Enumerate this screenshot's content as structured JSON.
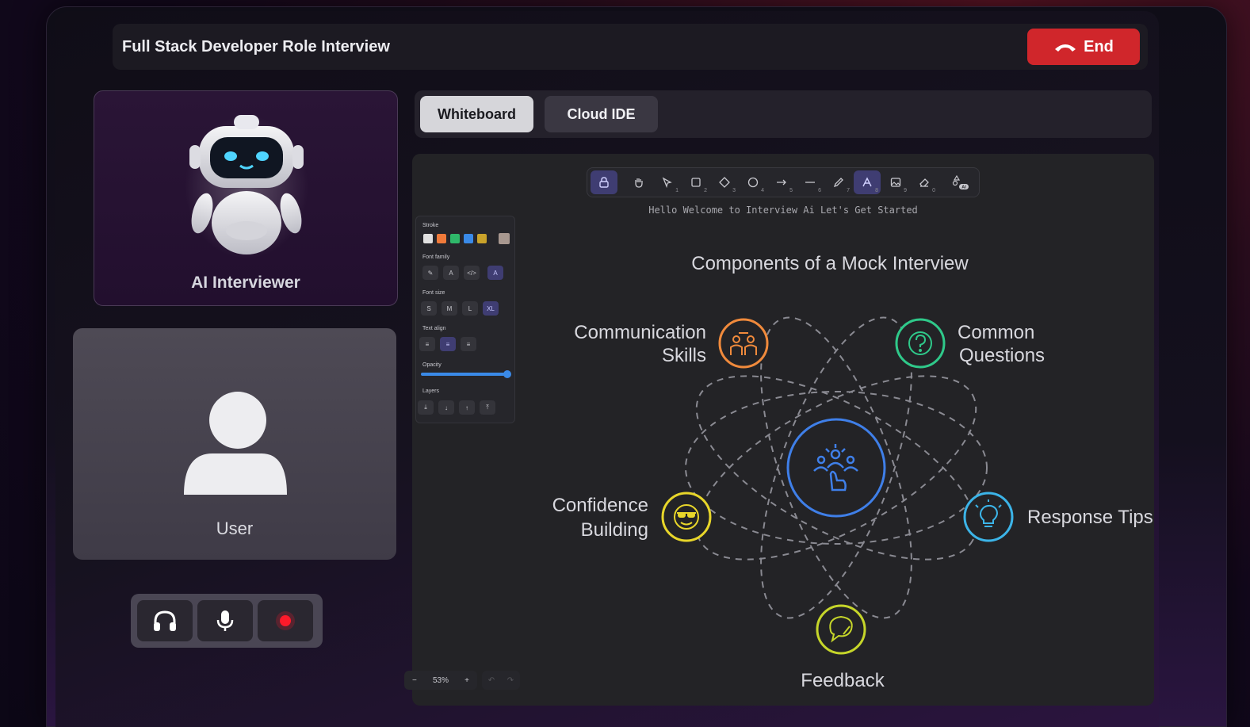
{
  "header": {
    "title": "Full Stack Developer Role Interview",
    "end_label": "End"
  },
  "ai_panel": {
    "label": "AI Interviewer"
  },
  "user_panel": {
    "label": "User"
  },
  "tabs": [
    {
      "label": "Whiteboard",
      "active": true
    },
    {
      "label": "Cloud IDE",
      "active": false
    }
  ],
  "toolbar": {
    "tools": [
      {
        "icon": "lock-icon",
        "num": "",
        "active": true
      },
      {
        "icon": "hand-icon",
        "num": "",
        "active": false
      },
      {
        "icon": "pointer-icon",
        "num": "1",
        "active": false
      },
      {
        "icon": "rectangle-icon",
        "num": "2",
        "active": false
      },
      {
        "icon": "diamond-icon",
        "num": "3",
        "active": false
      },
      {
        "icon": "ellipse-icon",
        "num": "4",
        "active": false
      },
      {
        "icon": "arrow-icon",
        "num": "5",
        "active": false
      },
      {
        "icon": "line-icon",
        "num": "6",
        "active": false
      },
      {
        "icon": "pencil-icon",
        "num": "7",
        "active": false
      },
      {
        "icon": "text-icon",
        "num": "8",
        "active": true
      },
      {
        "icon": "image-icon",
        "num": "9",
        "active": false
      },
      {
        "icon": "eraser-icon",
        "num": "0",
        "active": false
      },
      {
        "icon": "ai-shapes-icon",
        "num": "",
        "active": false
      }
    ]
  },
  "canvas": {
    "welcome_text": "Hello Welcome to Interview Ai Let's Get Started",
    "diagram_title": "Components of a Mock Interview",
    "nodes": {
      "communication": [
        "Communication",
        "Skills"
      ],
      "questions": [
        "Common",
        "Questions"
      ],
      "confidence": [
        "Confidence",
        "Building"
      ],
      "tips": [
        "Response Tips"
      ],
      "feedback": [
        "Feedback"
      ]
    },
    "colors": {
      "communication": "#f08a3c",
      "questions": "#2fc98a",
      "confidence": "#e8d62a",
      "tips": "#3cb4e8",
      "feedback": "#c6d62a",
      "center": "#3f7fe8"
    }
  },
  "props_panel": {
    "stroke_label": "Stroke",
    "stroke_colors": [
      "#e0e0e0",
      "#f07a3a",
      "#2fb86a",
      "#3a8ae8",
      "#c9a22a",
      "#a89890"
    ],
    "font_family_label": "Font family",
    "font_size_label": "Font size",
    "font_sizes": [
      "S",
      "M",
      "L",
      "XL"
    ],
    "text_align_label": "Text align",
    "opacity_label": "Opacity",
    "opacity": 1.0,
    "layers_label": "Layers"
  },
  "zoom": {
    "minus": "−",
    "value": "53%",
    "plus": "+"
  }
}
